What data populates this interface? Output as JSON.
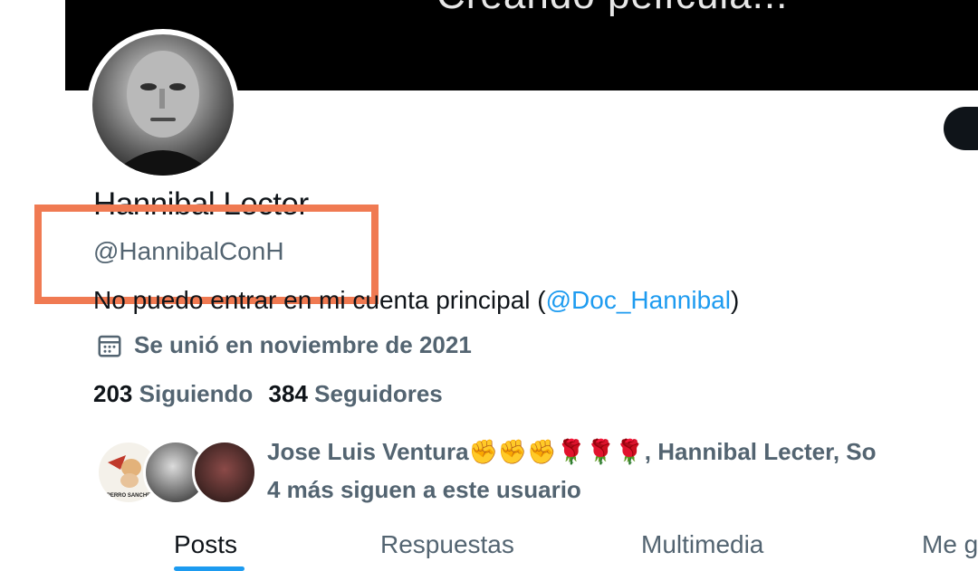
{
  "banner": {
    "text": "Creando película..."
  },
  "profile": {
    "display_name": "Hannibal Lecter",
    "handle": "@HannibalConH",
    "bio_prefix": "No puedo entrar en mi cuenta principal (",
    "bio_mention": "@Doc_Hannibal",
    "bio_suffix": ")",
    "joined": "Se unió en noviembre de 2021"
  },
  "stats": {
    "following_count": "203",
    "following_label": "Siguiendo",
    "followers_count": "384",
    "followers_label": "Seguidores"
  },
  "followers_you_know": {
    "line1": "Jose Luis Ventura✊✊✊🌹🌹🌹, Hannibal Lecter, So",
    "line2": "4 más siguen a este usuario",
    "avatar1_caption": "PERRO SANCHE"
  },
  "tabs": [
    {
      "label": "Posts"
    },
    {
      "label": "Respuestas"
    },
    {
      "label": "Multimedia"
    },
    {
      "label": "Me g"
    }
  ],
  "colors": {
    "accent": "#1d9bf0",
    "highlight": "#f07a52",
    "secondary_text": "#536471"
  }
}
